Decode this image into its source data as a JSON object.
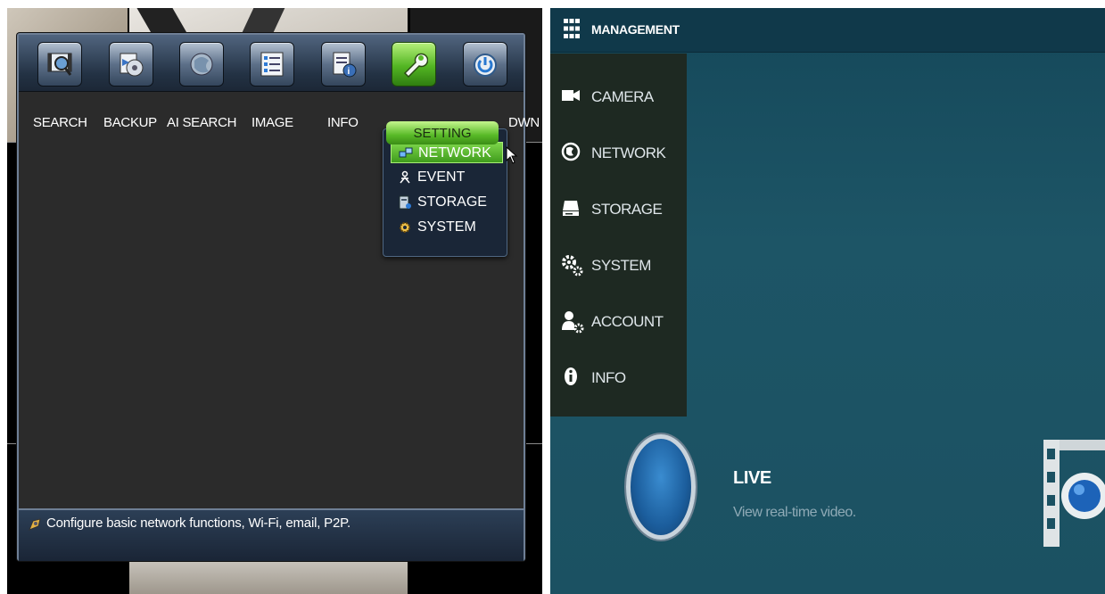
{
  "left_panel": {
    "toolbar": [
      {
        "label": "SEARCH",
        "icon": "search-film-icon"
      },
      {
        "label": "BACKUP",
        "icon": "backup-disc-icon"
      },
      {
        "label": "AI SEARCH",
        "icon": "ai-search-icon"
      },
      {
        "label": "IMAGE",
        "icon": "image-list-icon"
      },
      {
        "label": "INFO",
        "icon": "info-doc-icon"
      },
      {
        "label": "SETTING",
        "icon": "wrench-icon",
        "active": true
      },
      {
        "label": "DWN",
        "icon": "power-icon"
      }
    ],
    "dropdown": {
      "title": "SETTING",
      "items": [
        {
          "label": "NETWORK",
          "icon": "network-icon",
          "selected": true
        },
        {
          "label": "EVENT",
          "icon": "event-icon"
        },
        {
          "label": "STORAGE",
          "icon": "storage-icon"
        },
        {
          "label": "SYSTEM",
          "icon": "system-gear-icon"
        }
      ]
    },
    "status": {
      "icon": "hint-icon",
      "text": "Configure basic network functions, Wi-Fi, email, P2P."
    },
    "colors": {
      "active_green": "#58ba27",
      "toolbar_blue": "#233244"
    }
  },
  "right_panel": {
    "header": {
      "title": "MANAGEMENT",
      "icon": "grid-menu-icon"
    },
    "sidebar": [
      {
        "label": "CAMERA",
        "icon": "camera-icon"
      },
      {
        "label": "NETWORK",
        "icon": "globe-icon"
      },
      {
        "label": "STORAGE",
        "icon": "drive-icon"
      },
      {
        "label": "SYSTEM",
        "icon": "gears-icon"
      },
      {
        "label": "ACCOUNT",
        "icon": "user-gear-icon"
      },
      {
        "label": "INFO",
        "icon": "info-icon"
      }
    ],
    "live": {
      "title": "LIVE",
      "description": "View real-time video."
    },
    "colors": {
      "background": "#1d5566",
      "sidebar": "#1e2922"
    }
  }
}
